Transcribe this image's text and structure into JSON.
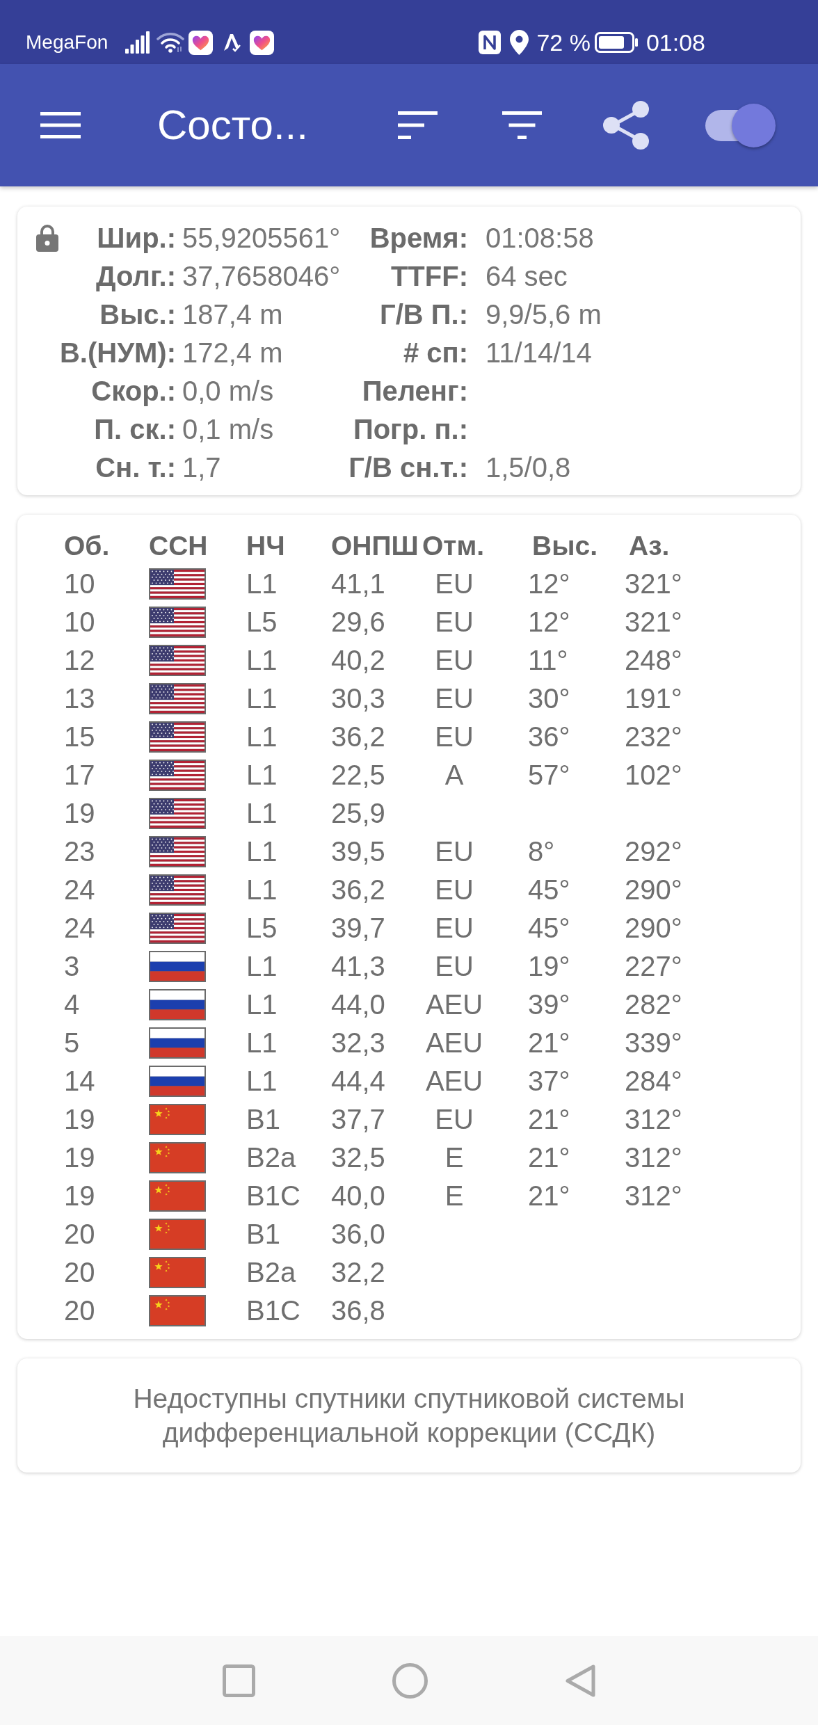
{
  "status_bar": {
    "carrier": "MegaFon",
    "battery": "72 %",
    "time": "01:08"
  },
  "app_bar": {
    "title": "Состо...",
    "switch": {
      "on": true
    }
  },
  "fix_info": {
    "locked": true,
    "rows": [
      {
        "left": {
          "label": "Шир.:",
          "value": "55,9205561°"
        },
        "right": {
          "label": "Время:",
          "value": "01:08:58"
        }
      },
      {
        "left": {
          "label": "Долг.:",
          "value": "37,7658046°"
        },
        "right": {
          "label": "TTFF:",
          "value": "64 sec"
        }
      },
      {
        "left": {
          "label": "Выс.:",
          "value": "187,4 m"
        },
        "right": {
          "label": "Г/В П.:",
          "value": "9,9/5,6 m"
        }
      },
      {
        "left": {
          "label": "В.(НУМ):",
          "value": "172,4 m"
        },
        "right": {
          "label": "# сп:",
          "value": "11/14/14"
        }
      },
      {
        "left": {
          "label": "Скор.:",
          "value": "0,0 m/s"
        },
        "right": {
          "label": "Пеленг:"
        }
      },
      {
        "left": {
          "label": "П. ск.:",
          "value": "0,1 m/s"
        },
        "right": {
          "label": "Погр. п.:"
        }
      },
      {
        "left": {
          "label": "Сн. т.:",
          "value": "1,7"
        },
        "right": {
          "label": "Г/В сн.т.:",
          "value": "1,5/0,8"
        }
      }
    ]
  },
  "satellites": {
    "columns": [
      "Об.",
      "ССН",
      "НЧ",
      "ОНПШ",
      "Отм.",
      "Выс.",
      "Аз."
    ],
    "rows": [
      {
        "id": "10",
        "kind": "us",
        "band": "L1",
        "snr": "41,1",
        "flags": "EU",
        "elevation": "12°",
        "azimuth": "321°"
      },
      {
        "id": "10",
        "kind": "us",
        "band": "L5",
        "snr": "29,6",
        "flags": "EU",
        "elevation": "12°",
        "azimuth": "321°"
      },
      {
        "id": "12",
        "kind": "us",
        "band": "L1",
        "snr": "40,2",
        "flags": "EU",
        "elevation": "11°",
        "azimuth": "248°"
      },
      {
        "id": "13",
        "kind": "us",
        "band": "L1",
        "snr": "30,3",
        "flags": "EU",
        "elevation": "30°",
        "azimuth": "191°"
      },
      {
        "id": "15",
        "kind": "us",
        "band": "L1",
        "snr": "36,2",
        "flags": "EU",
        "elevation": "36°",
        "azimuth": "232°"
      },
      {
        "id": "17",
        "kind": "us",
        "band": "L1",
        "snr": "22,5",
        "flags": "A",
        "elevation": "57°",
        "azimuth": "102°"
      },
      {
        "id": "19",
        "kind": "us",
        "band": "L1",
        "snr": "25,9"
      },
      {
        "id": "23",
        "kind": "us",
        "band": "L1",
        "snr": "39,5",
        "flags": "EU",
        "elevation": "8°",
        "azimuth": "292°"
      },
      {
        "id": "24",
        "kind": "us",
        "band": "L1",
        "snr": "36,2",
        "flags": "EU",
        "elevation": "45°",
        "azimuth": "290°"
      },
      {
        "id": "24",
        "kind": "us",
        "band": "L5",
        "snr": "39,7",
        "flags": "EU",
        "elevation": "45°",
        "azimuth": "290°"
      },
      {
        "id": "3",
        "kind": "ru",
        "band": "L1",
        "snr": "41,3",
        "flags": "EU",
        "elevation": "19°",
        "azimuth": "227°"
      },
      {
        "id": "4",
        "kind": "ru",
        "band": "L1",
        "snr": "44,0",
        "flags": "AEU",
        "elevation": "39°",
        "azimuth": "282°"
      },
      {
        "id": "5",
        "kind": "ru",
        "band": "L1",
        "snr": "32,3",
        "flags": "AEU",
        "elevation": "21°",
        "azimuth": "339°"
      },
      {
        "id": "14",
        "kind": "ru",
        "band": "L1",
        "snr": "44,4",
        "flags": "AEU",
        "elevation": "37°",
        "azimuth": "284°"
      },
      {
        "id": "19",
        "kind": "cn",
        "band": "B1",
        "snr": "37,7",
        "flags": "EU",
        "elevation": "21°",
        "azimuth": "312°"
      },
      {
        "id": "19",
        "kind": "cn",
        "band": "B2a",
        "snr": "32,5",
        "flags": "E",
        "elevation": "21°",
        "azimuth": "312°"
      },
      {
        "id": "19",
        "kind": "cn",
        "band": "B1C",
        "snr": "40,0",
        "flags": "E",
        "elevation": "21°",
        "azimuth": "312°"
      },
      {
        "id": "20",
        "kind": "cn",
        "band": "B1",
        "snr": "36,0"
      },
      {
        "id": "20",
        "kind": "cn",
        "band": "B2a",
        "snr": "32,2"
      },
      {
        "id": "20",
        "kind": "cn",
        "band": "B1C",
        "snr": "36,8"
      }
    ]
  },
  "message": "Недоступны спутники спутниковой системы дифференциальной коррекции (ССДК)"
}
